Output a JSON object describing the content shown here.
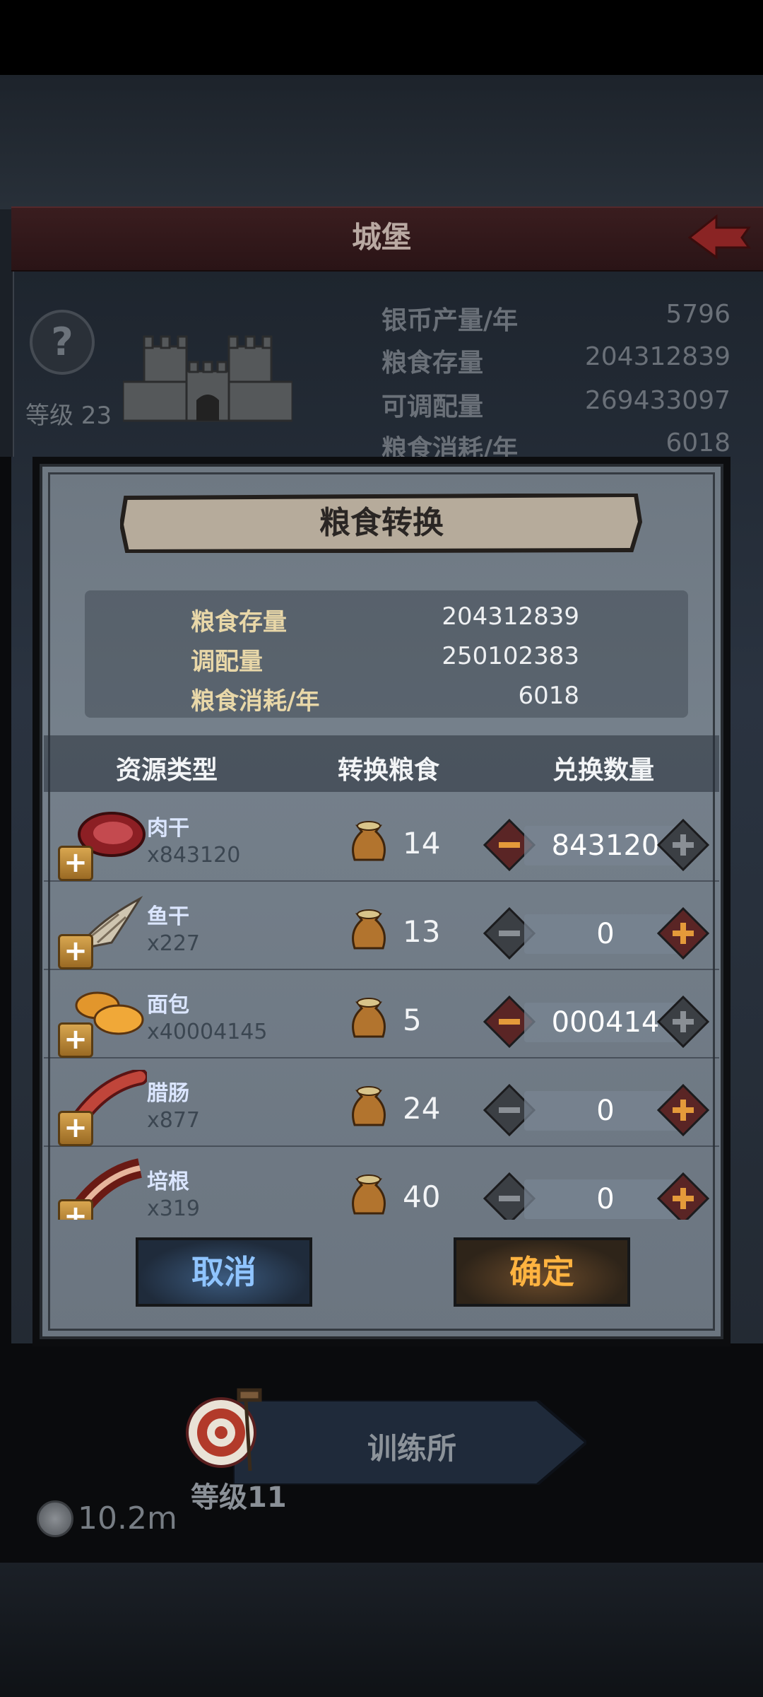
{
  "castle": {
    "title": "城堡",
    "level": "等级 23",
    "stats": [
      {
        "label": "银币产量/年",
        "value": "5796"
      },
      {
        "label": "粮食存量",
        "value": "204312839"
      },
      {
        "label": "可调配量",
        "value": "269433097"
      },
      {
        "label": "粮食消耗/年",
        "value": "6018"
      }
    ]
  },
  "training": {
    "label": "训练所",
    "level": "等级11"
  },
  "silver": "10.2m",
  "dialog": {
    "title": "粮食转换",
    "info": [
      {
        "label": "粮食存量",
        "value": "204312839"
      },
      {
        "label": "调配量",
        "value": "250102383"
      },
      {
        "label": "粮食消耗/年",
        "value": "6018"
      }
    ],
    "columns": {
      "type": "资源类型",
      "convert": "转换粮食",
      "amount": "兑换数量"
    },
    "rows": [
      {
        "name": "肉干",
        "count": "x843120",
        "convert": "14",
        "amount": "843120",
        "icon": "jerky-icon"
      },
      {
        "name": "鱼干",
        "count": "x227",
        "convert": "13",
        "amount": "0",
        "icon": "dried-fish-icon"
      },
      {
        "name": "面包",
        "count": "x40004145",
        "convert": "5",
        "amount": "000414",
        "icon": "bread-icon"
      },
      {
        "name": "腊肠",
        "count": "x877",
        "convert": "24",
        "amount": "0",
        "icon": "sausage-icon"
      },
      {
        "name": "培根",
        "count": "x319",
        "convert": "40",
        "amount": "0",
        "icon": "bacon-icon"
      }
    ],
    "cancel_label": "取消",
    "confirm_label": "确定"
  }
}
